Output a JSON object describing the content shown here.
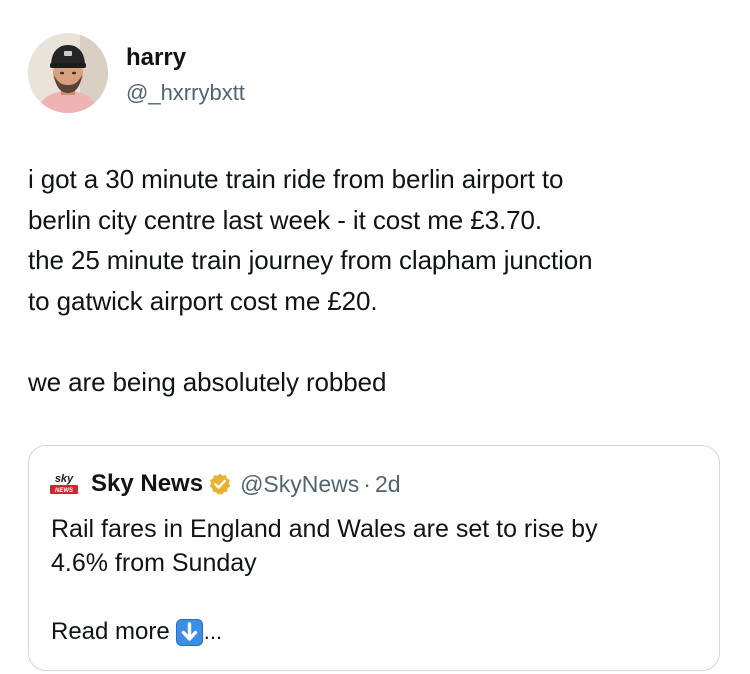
{
  "author": {
    "display_name": "harry",
    "handle": "@_hxrrybxtt",
    "avatar_icon": "profile-photo"
  },
  "tweet": {
    "lines": [
      "i got a 30 minute train ride from berlin airport to",
      "berlin city centre last week - it cost me £3.70.",
      "the 25 minute train journey from clapham junction",
      "to gatwick airport cost me £20."
    ],
    "closing": "we are being absolutely robbed"
  },
  "quote": {
    "logo_text": "sky",
    "logo_subtext": "NEWS",
    "display_name": "Sky News",
    "verified_icon": "verified-badge-gold",
    "handle": "@SkyNews",
    "separator": "·",
    "time": "2d",
    "text_lines": [
      "Rail fares in England and Wales are set to rise by",
      "4.6% from Sunday"
    ],
    "read_more_label": "Read more",
    "read_more_icon": "down-arrow-emoji",
    "ellipsis": "..."
  },
  "colors": {
    "text": "#0f1419",
    "secondary": "#536471",
    "border": "#cfd9de",
    "verified_gold": "#e8b130",
    "sky_red": "#d1262f",
    "arrow_blue": "#3a8ee6"
  }
}
